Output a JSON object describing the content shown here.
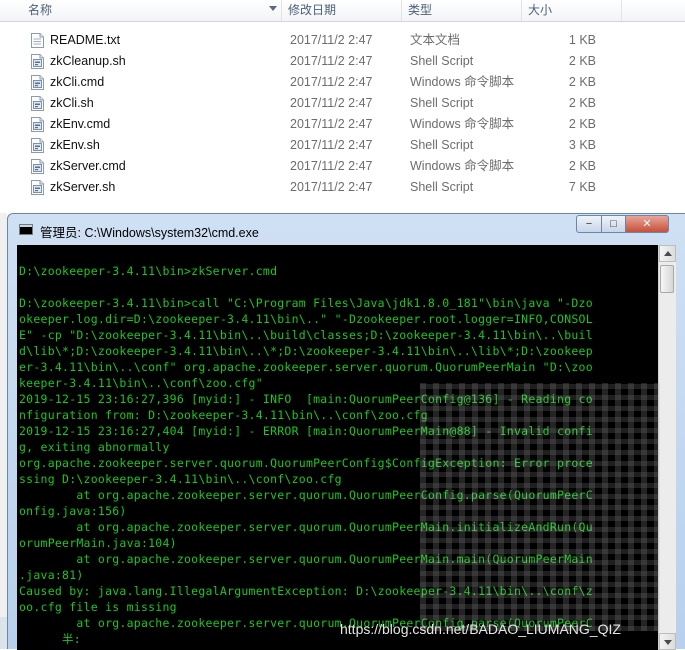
{
  "explorer": {
    "columns": {
      "name": "名称",
      "date": "修改日期",
      "type": "类型",
      "size": "大小"
    },
    "files": [
      {
        "name": "README.txt",
        "date": "2017/11/2 2:47",
        "type": "文本文档",
        "size": "1 KB",
        "icon": "text-file-icon"
      },
      {
        "name": "zkCleanup.sh",
        "date": "2017/11/2 2:47",
        "type": "Shell Script",
        "size": "2 KB",
        "icon": "script-file-icon"
      },
      {
        "name": "zkCli.cmd",
        "date": "2017/11/2 2:47",
        "type": "Windows 命令脚本",
        "size": "2 KB",
        "icon": "cmd-file-icon"
      },
      {
        "name": "zkCli.sh",
        "date": "2017/11/2 2:47",
        "type": "Shell Script",
        "size": "2 KB",
        "icon": "script-file-icon"
      },
      {
        "name": "zkEnv.cmd",
        "date": "2017/11/2 2:47",
        "type": "Windows 命令脚本",
        "size": "2 KB",
        "icon": "cmd-file-icon"
      },
      {
        "name": "zkEnv.sh",
        "date": "2017/11/2 2:47",
        "type": "Shell Script",
        "size": "3 KB",
        "icon": "script-file-icon"
      },
      {
        "name": "zkServer.cmd",
        "date": "2017/11/2 2:47",
        "type": "Windows 命令脚本",
        "size": "2 KB",
        "icon": "cmd-file-icon"
      },
      {
        "name": "zkServer.sh",
        "date": "2017/11/2 2:47",
        "type": "Shell Script",
        "size": "7 KB",
        "icon": "script-file-icon"
      }
    ]
  },
  "cmd_window": {
    "title": "管理员: C:\\Windows\\system32\\cmd.exe",
    "buttons": {
      "minimize": "−",
      "maximize": "□",
      "close": "✕"
    },
    "console_lines": [
      "",
      "D:\\zookeeper-3.4.11\\bin>zkServer.cmd",
      "",
      "D:\\zookeeper-3.4.11\\bin>call \"C:\\Program Files\\Java\\jdk1.8.0_181\"\\bin\\java \"-Dzo",
      "okeeper.log.dir=D:\\zookeeper-3.4.11\\bin\\..\" \"-Dzookeeper.root.logger=INFO,CONSOL",
      "E\" -cp \"D:\\zookeeper-3.4.11\\bin\\..\\build\\classes;D:\\zookeeper-3.4.11\\bin\\..\\buil",
      "d\\lib\\*;D:\\zookeeper-3.4.11\\bin\\..\\*;D:\\zookeeper-3.4.11\\bin\\..\\lib\\*;D:\\zookeep",
      "er-3.4.11\\bin\\..\\conf\" org.apache.zookeeper.server.quorum.QuorumPeerMain \"D:\\zoo",
      "keeper-3.4.11\\bin\\..\\conf\\zoo.cfg\"",
      "2019-12-15 23:16:27,396 [myid:] - INFO  [main:QuorumPeerConfig@136] - Reading co",
      "nfiguration from: D:\\zookeeper-3.4.11\\bin\\..\\conf\\zoo.cfg",
      "2019-12-15 23:16:27,404 [myid:] - ERROR [main:QuorumPeerMain@88] - Invalid confi",
      "g, exiting abnormally",
      "org.apache.zookeeper.server.quorum.QuorumPeerConfig$ConfigException: Error proce",
      "ssing D:\\zookeeper-3.4.11\\bin\\..\\conf\\zoo.cfg",
      "        at org.apache.zookeeper.server.quorum.QuorumPeerConfig.parse(QuorumPeerC",
      "onfig.java:156)",
      "        at org.apache.zookeeper.server.quorum.QuorumPeerMain.initializeAndRun(Qu",
      "orumPeerMain.java:104)",
      "        at org.apache.zookeeper.server.quorum.QuorumPeerMain.main(QuorumPeerMain",
      ".java:81)",
      "Caused by: java.lang.IllegalArgumentException: D:\\zookeeper-3.4.11\\bin\\..\\conf\\z",
      "oo.cfg file is missing",
      "        at org.apache.zookeeper.server.quorum.QuorumPeerConfig.parse(QuorumPeerC",
      "      半:"
    ]
  },
  "watermark": "https://blog.csdn.net/BADAO_LIUMANG_QIZ"
}
